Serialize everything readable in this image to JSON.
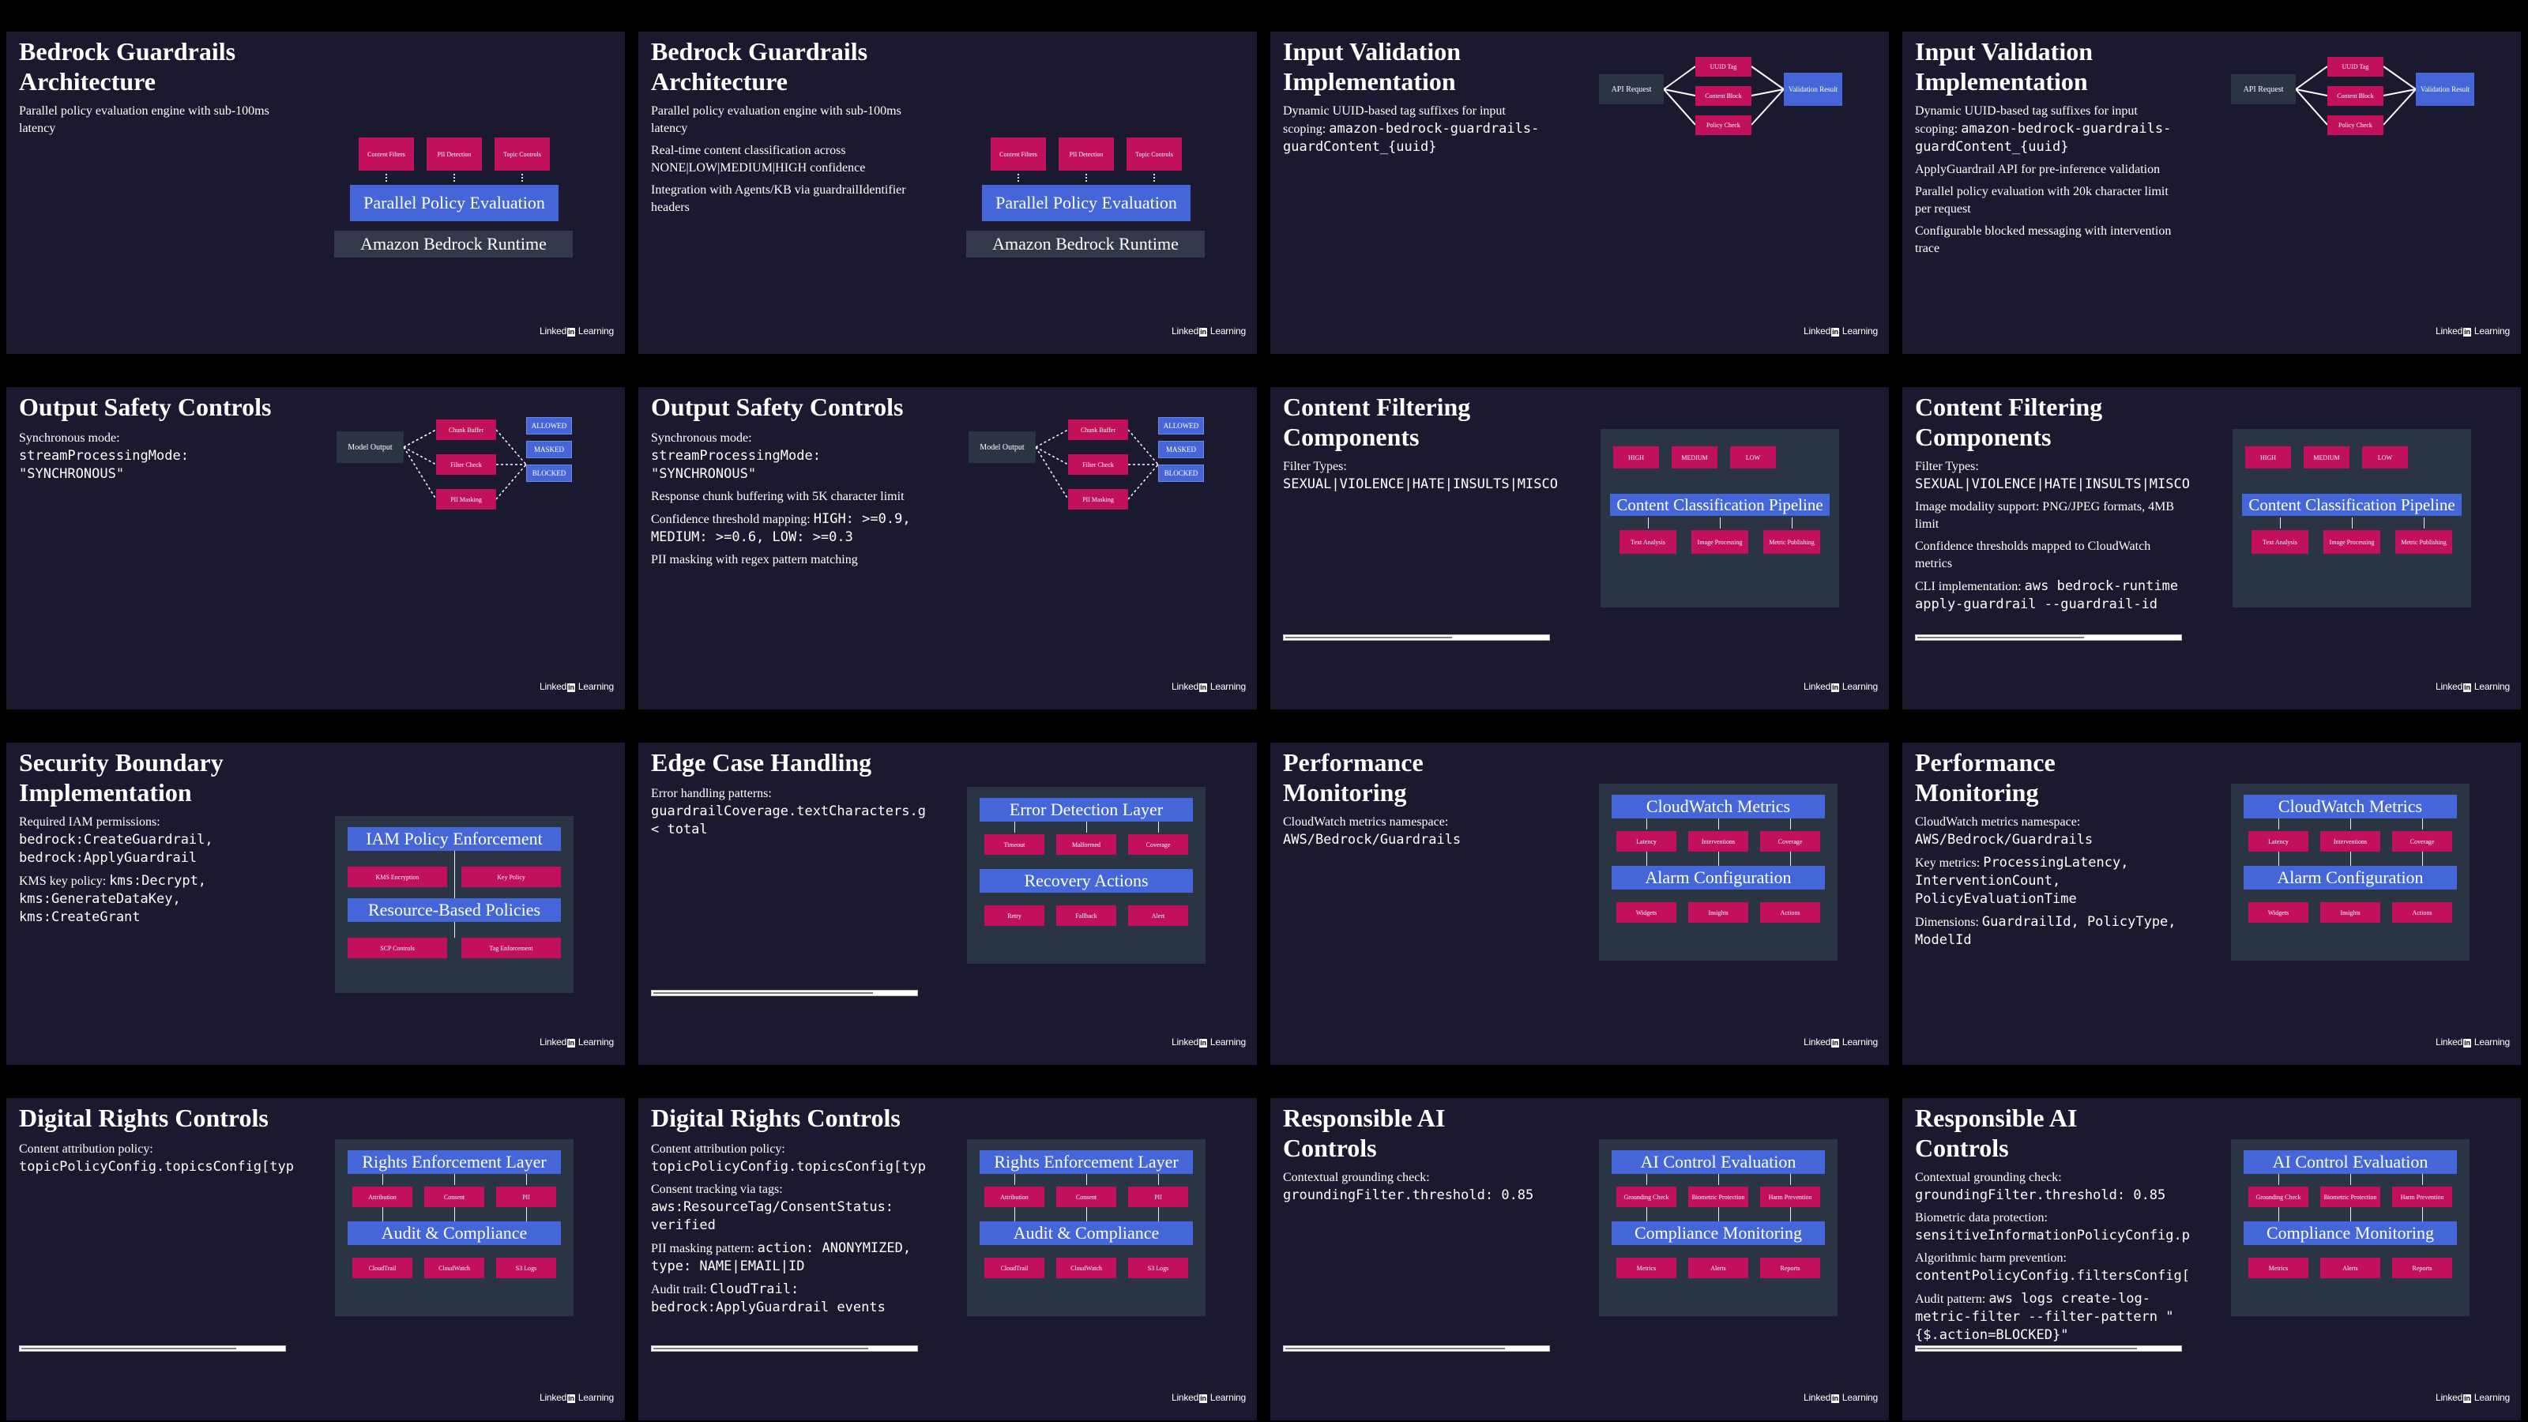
{
  "brand": {
    "pre": "Linked",
    "in": "in",
    "post": " Learning"
  },
  "s1": {
    "title": "Bedrock Guardrails Architecture",
    "bullets": [
      "Parallel policy evaluation engine with sub-100ms latency"
    ],
    "diagram": {
      "boxes": [
        "Content Filters",
        "PII Detection",
        "Topic Controls"
      ],
      "engine": "Parallel Policy Evaluation",
      "runtime": "Amazon Bedrock Runtime"
    }
  },
  "s2": {
    "title": "Bedrock Guardrails Architecture",
    "bullets": [
      "Parallel policy evaluation engine with sub-100ms latency",
      "Real-time content classification across NONE|LOW|MEDIUM|HIGH confidence",
      "Integration with Agents/KB via guardrailIdentifier headers"
    ],
    "diagram": {
      "boxes": [
        "Content Filters",
        "PII Detection",
        "Topic Controls"
      ],
      "engine": "Parallel Policy Evaluation",
      "runtime": "Amazon Bedrock Runtime"
    }
  },
  "s3": {
    "title": "Input Validation Implementation",
    "b1_text": "Dynamic UUID-based tag suffixes for input scoping: ",
    "b1_code": "amazon-bedrock-guardrails-guardContent_{uuid}",
    "diagram": {
      "source": "API Request",
      "mid": [
        "UUID Tag",
        "Content Block",
        "Policy Check"
      ],
      "result": "Validation Result"
    }
  },
  "s4": {
    "title": "Input Validation Implementation",
    "b1_text": "Dynamic UUID-based tag suffixes for input scoping: ",
    "b1_code": "amazon-bedrock-guardrails-guardContent_{uuid}",
    "bullets": [
      "ApplyGuardrail API for pre-inference validation",
      "Parallel policy evaluation with 20k character limit per request",
      "Configurable blocked messaging with intervention trace"
    ],
    "diagram": {
      "source": "API Request",
      "mid": [
        "UUID Tag",
        "Content Block",
        "Policy Check"
      ],
      "result": "Validation Result"
    }
  },
  "s5": {
    "title": "Output Safety Controls",
    "b1_text": "Synchronous mode: ",
    "b1_code": "streamProcessingMode: \"SYNCHRONOUS\"",
    "diagram": {
      "source": "Model Output",
      "mid": [
        "Chunk Buffer",
        "Filter Check",
        "PII Masking"
      ],
      "out": [
        "ALLOWED",
        "MASKED",
        "BLOCKED"
      ]
    }
  },
  "s6": {
    "title": "Output Safety Controls",
    "b1_text": "Synchronous mode: ",
    "b1_code": "streamProcessingMode: \"SYNCHRONOUS\"",
    "b2": "Response chunk buffering with 5K character limit",
    "b3_text": "Confidence threshold mapping: ",
    "b3_code": "HIGH: >=0.9, MEDIUM: >=0.6, LOW: >=0.3",
    "b4": "PII masking with regex pattern matching",
    "diagram": {
      "source": "Model Output",
      "mid": [
        "Chunk Buffer",
        "Filter Check",
        "PII Masking"
      ],
      "out": [
        "ALLOWED",
        "MASKED",
        "BLOCKED"
      ]
    }
  },
  "s7": {
    "title": "Content Filtering Components",
    "b1_text": "Filter Types: ",
    "b1_code": "SEXUAL|VIOLENCE|HATE|INSULTS|MISCO",
    "progress": 0.64,
    "diagram": {
      "levels": [
        "HIGH",
        "MEDIUM",
        "LOW"
      ],
      "pipeline": "Content Classification Pipeline",
      "stages": [
        "Text Analysis",
        "Image Processing",
        "Metric Publishing"
      ]
    }
  },
  "s8": {
    "title": "Content Filtering Components",
    "b1_text": "Filter Types: ",
    "b1_code": "SEXUAL|VIOLENCE|HATE|INSULTS|MISCO",
    "b2": "Image modality support: PNG/JPEG formats, 4MB limit",
    "b3": "Confidence thresholds mapped to CloudWatch metrics",
    "b4_text": "CLI implementation: ",
    "b4_code": "aws bedrock-runtime apply-guardrail --guardrail-id",
    "progress": 0.64,
    "diagram": {
      "levels": [
        "HIGH",
        "MEDIUM",
        "LOW"
      ],
      "pipeline": "Content Classification Pipeline",
      "stages": [
        "Text Analysis",
        "Image Processing",
        "Metric Publishing"
      ]
    }
  },
  "s9": {
    "title": "Security Boundary Implementation",
    "b1_text": "Required IAM permissions: ",
    "b1_code": "bedrock:CreateGuardrail, bedrock:ApplyGuardrail",
    "b2_text": "KMS key policy: ",
    "b2_code": "kms:Decrypt, kms:GenerateDataKey, kms:CreateGrant",
    "diagram": {
      "top": "IAM Policy Enforcement",
      "row1": [
        "KMS Encryption",
        "Key Policy"
      ],
      "mid": "Resource-Based Policies",
      "row2": [
        "SCP Controls",
        "Tag Enforcement"
      ]
    }
  },
  "s10": {
    "title": "Edge Case Handling",
    "b1_text": "Error handling patterns: ",
    "b1_code": "guardrailCoverage.textCharacters.g < total",
    "progress": 0.84,
    "diagram": {
      "top": "Error Detection Layer",
      "row1": [
        "Timeout",
        "Malformed",
        "Coverage"
      ],
      "mid": "Recovery Actions",
      "row2": [
        "Retry",
        "Fallback",
        "Alert"
      ]
    }
  },
  "s11": {
    "title": "Performance Monitoring",
    "b1_text": "CloudWatch metrics namespace: ",
    "b1_code": "AWS/Bedrock/Guardrails",
    "diagram": {
      "top": "CloudWatch Metrics",
      "row1": [
        "Latency",
        "Interventions",
        "Coverage"
      ],
      "mid": "Alarm Configuration",
      "row2": [
        "Widgets",
        "Insights",
        "Actions"
      ]
    }
  },
  "s12": {
    "title": "Performance Monitoring",
    "b1_text": "CloudWatch metrics namespace: ",
    "b1_code": "AWS/Bedrock/Guardrails",
    "b2_text": "Key metrics: ",
    "b2_code": "ProcessingLatency, InterventionCount, PolicyEvaluationTime",
    "b3_text": "Dimensions: ",
    "b3_code": "GuardrailId, PolicyType, ModelId",
    "diagram": {
      "top": "CloudWatch Metrics",
      "row1": [
        "Latency",
        "Interventions",
        "Coverage"
      ],
      "mid": "Alarm Configuration",
      "row2": [
        "Widgets",
        "Insights",
        "Actions"
      ]
    }
  },
  "s13": {
    "title": "Digital Rights Controls",
    "b1_text": "Content attribution policy: ",
    "b1_code": "topicPolicyConfig.topicsConfig[typ",
    "progress": 0.82,
    "diagram": {
      "top": "Rights Enforcement Layer",
      "row1": [
        "Attribution",
        "Consent",
        "PII"
      ],
      "mid": "Audit & Compliance",
      "row2": [
        "CloudTrail",
        "CloudWatch",
        "S3 Logs"
      ]
    }
  },
  "s14": {
    "title": "Digital Rights Controls",
    "b1_text": "Content attribution policy: ",
    "b1_code": "topicPolicyConfig.topicsConfig[typ",
    "b2_text": "Consent tracking via tags: ",
    "b2_code": "aws:ResourceTag/ConsentStatus: verified",
    "b3_text": "PII masking pattern: ",
    "b3_code": "action: ANONYMIZED, type: NAME|EMAIL|ID",
    "b4_text": "Audit trail: ",
    "b4_code": "CloudTrail: bedrock:ApplyGuardrail events",
    "progress": 0.82,
    "diagram": {
      "top": "Rights Enforcement Layer",
      "row1": [
        "Attribution",
        "Consent",
        "PII"
      ],
      "mid": "Audit & Compliance",
      "row2": [
        "CloudTrail",
        "CloudWatch",
        "S3 Logs"
      ]
    }
  },
  "s15": {
    "title": "Responsible AI Controls",
    "b1_text": "Contextual grounding check: ",
    "b1_code": "groundingFilter.threshold: 0.85",
    "progress": 0.84,
    "diagram": {
      "top": "AI Control Evaluation",
      "row1": [
        "Grounding Check",
        "Biometric Protection",
        "Harm Prevention"
      ],
      "mid": "Compliance Monitoring",
      "row2": [
        "Metrics",
        "Alerts",
        "Reports"
      ]
    }
  },
  "s16": {
    "title": "Responsible AI Controls",
    "b1_text": "Contextual grounding check: ",
    "b1_code": "groundingFilter.threshold: 0.85",
    "b2_text": "Biometric data protection: ",
    "b2_code": "sensitiveInformationPolicyConfig.p",
    "b3_text": "Algorithmic harm prevention: ",
    "b3_code": "contentPolicyConfig.filtersConfig[",
    "b4_text": "Audit pattern: ",
    "b4_code": "aws logs create-log-metric-filter --filter-pattern \"{$.action=BLOCKED}\"",
    "progress": 0.84,
    "diagram": {
      "top": "AI Control Evaluation",
      "row1": [
        "Grounding Check",
        "Biometric Protection",
        "Harm Prevention"
      ],
      "mid": "Compliance Monitoring",
      "row2": [
        "Metrics",
        "Alerts",
        "Reports"
      ]
    }
  }
}
